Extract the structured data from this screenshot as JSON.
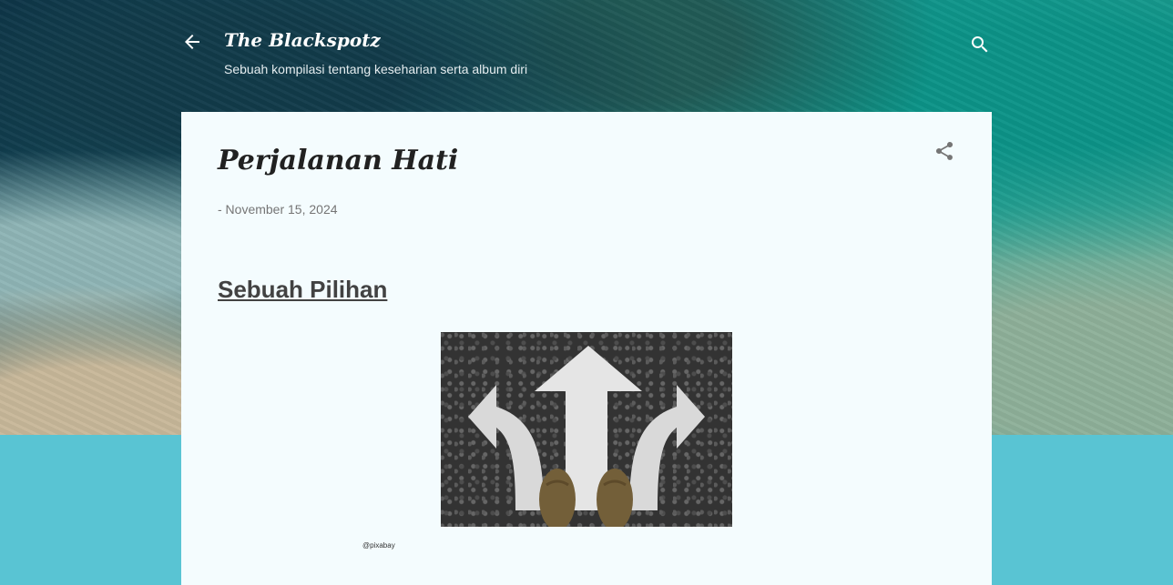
{
  "header": {
    "title": "The Blackspotz",
    "description": "Sebuah kompilasi tentang keseharian serta album diri",
    "back_icon": "arrow-back-icon",
    "search_icon": "search-icon"
  },
  "post": {
    "title": "Perjalanan Hati",
    "date": "- November 15, 2024",
    "share_icon": "share-icon",
    "heading": "Sebuah Pilihan",
    "image_caption": "@pixabay"
  },
  "colors": {
    "page_background": "#59c4d3",
    "card_background": "#f4fcfe",
    "header_text": "#ffffff",
    "date_text": "#757575",
    "heading_text": "#424242"
  }
}
